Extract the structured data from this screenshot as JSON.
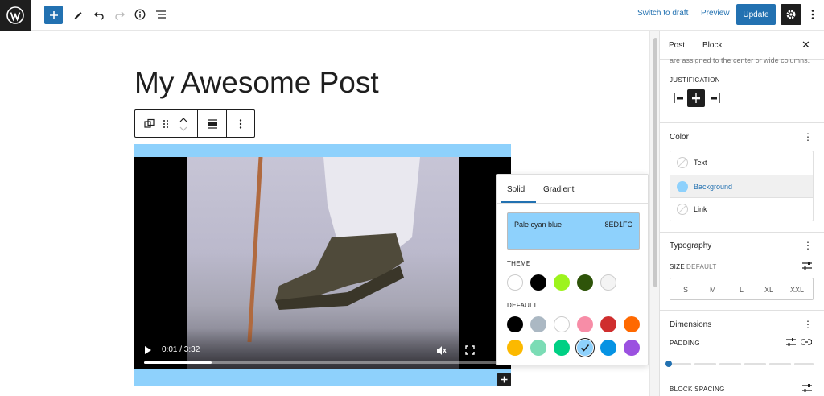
{
  "topbar": {
    "switch_to_draft": "Switch to draft",
    "preview": "Preview",
    "update": "Update",
    "icons": [
      "wordpress-logo-icon",
      "plus-icon",
      "pencil-icon",
      "undo-icon",
      "redo-icon",
      "info-icon",
      "list-view-icon",
      "gear-icon",
      "more-vertical-icon"
    ]
  },
  "editor": {
    "post_title": "My Awesome Post",
    "video": {
      "time": "0:01 / 3:32",
      "progress_fraction": 0.19
    }
  },
  "popover": {
    "tabs": [
      {
        "label": "Solid",
        "active": true
      },
      {
        "label": "Gradient",
        "active": false
      }
    ],
    "selected": {
      "name": "Pale cyan blue",
      "hex": "8ED1FC",
      "color": "#8ed1fc"
    },
    "theme_heading": "THEME",
    "theme_colors": [
      "#ffffff",
      "#000000",
      "#9df31c",
      "#2e5409",
      "#f4f4f4"
    ],
    "default_heading": "DEFAULT",
    "default_colors": [
      "#000000",
      "#abb8c3",
      "#ffffff",
      "#f78da7",
      "#cf2e2e",
      "#ff6900",
      "#fcb900",
      "#7bdcb5",
      "#00d084",
      "#8ed1fc",
      "#0693e3",
      "#9b51e0"
    ],
    "selected_default_index": 9
  },
  "sidebar": {
    "tabs": [
      {
        "label": "Post"
      },
      {
        "label": "Block"
      }
    ],
    "cutoff_text": "are assigned to the center or wide columns.",
    "justification_label": "JUSTIFICATION",
    "color": {
      "title": "Color",
      "items": [
        {
          "label": "Text",
          "color": "",
          "active": false
        },
        {
          "label": "Background",
          "color": "#8ed1fc",
          "active": true
        },
        {
          "label": "Link",
          "color": "",
          "active": false
        }
      ]
    },
    "typography": {
      "title": "Typography",
      "size_label": "SIZE",
      "size_value": "DEFAULT",
      "sizes": [
        "S",
        "M",
        "L",
        "XL",
        "XXL"
      ]
    },
    "dimensions": {
      "title": "Dimensions",
      "padding_label": "PADDING",
      "block_spacing_label": "BLOCK SPACING"
    }
  }
}
